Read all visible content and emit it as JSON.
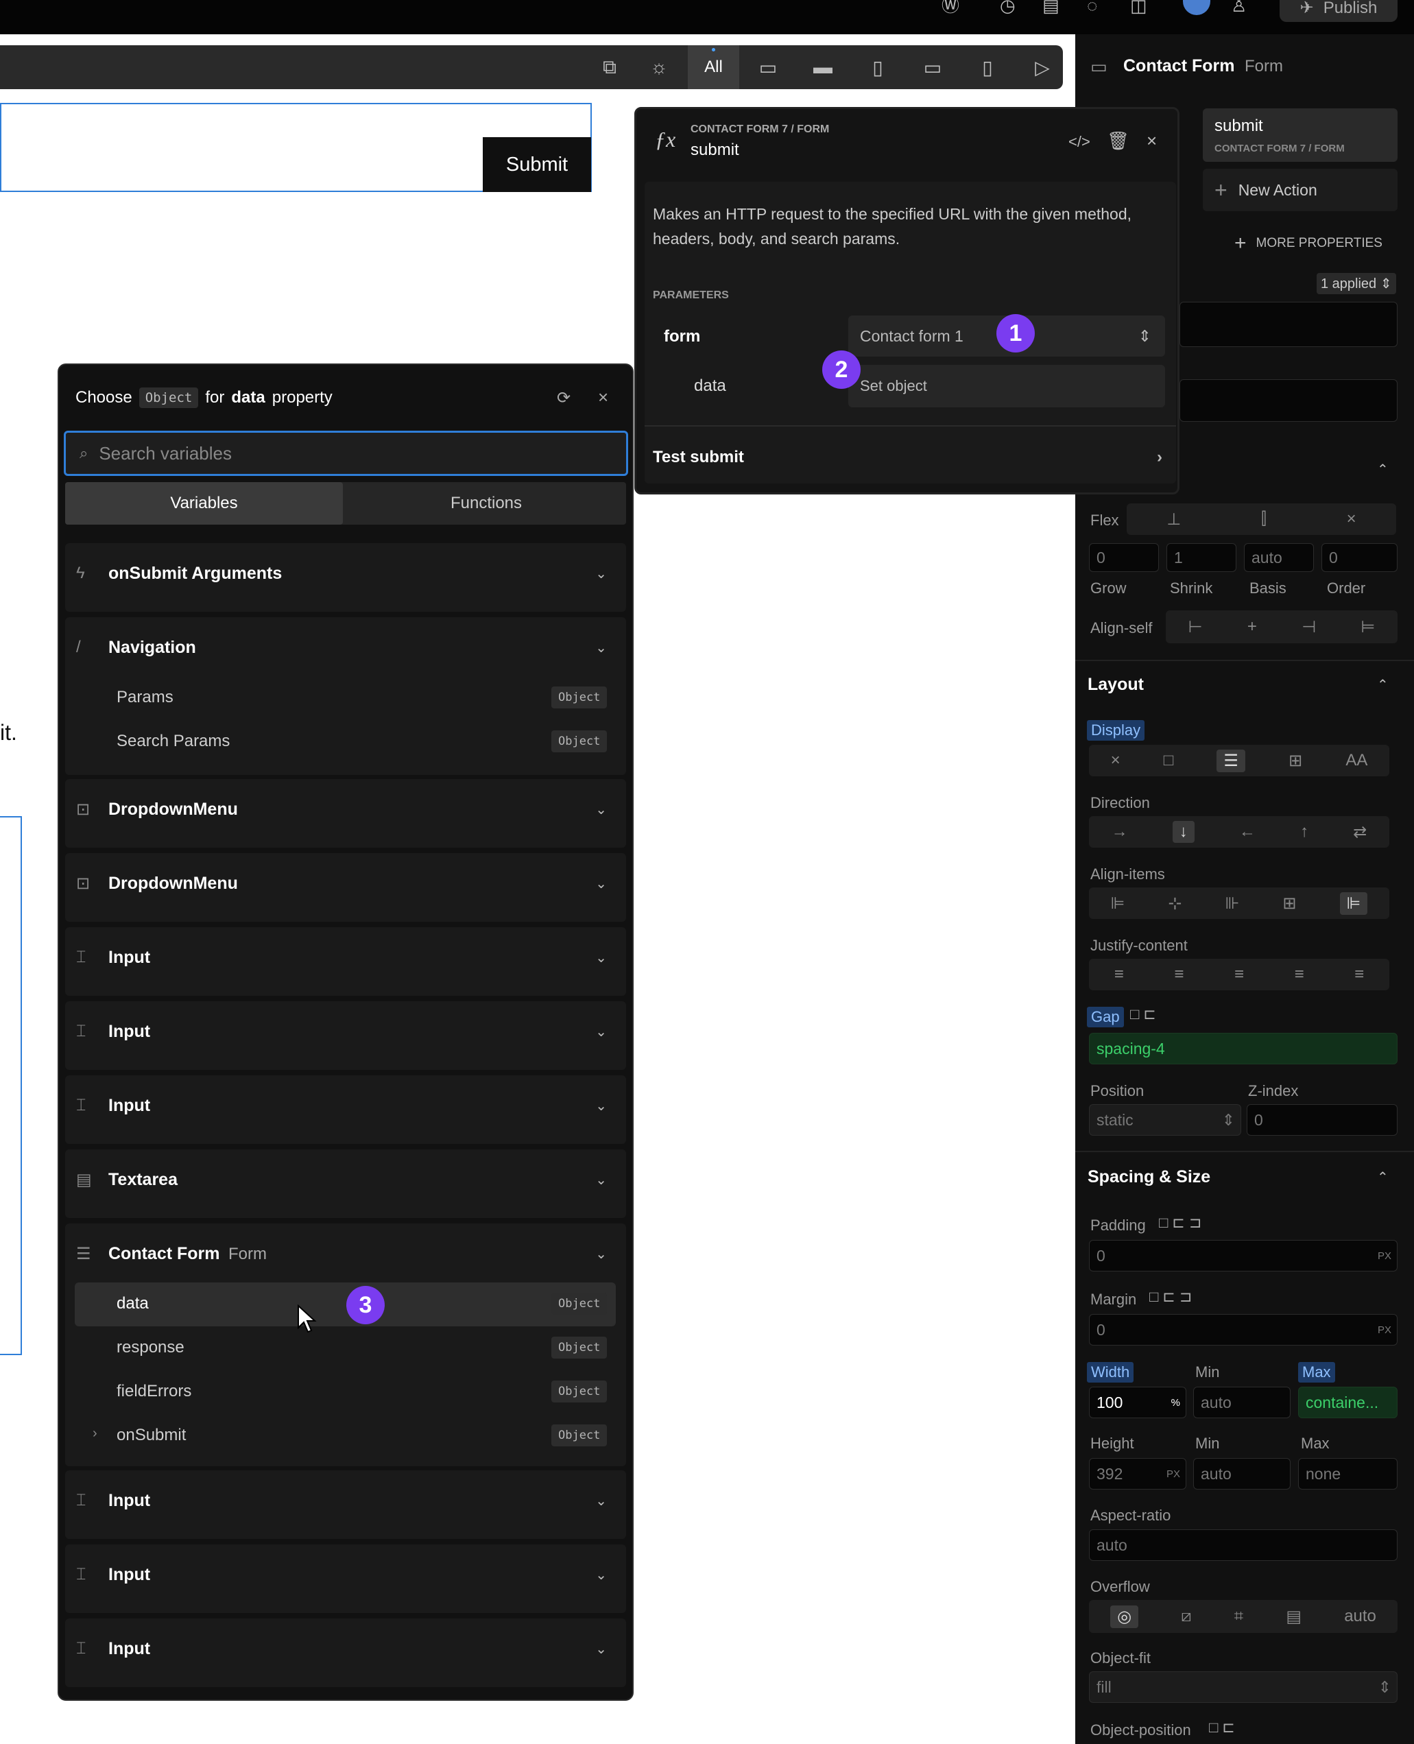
{
  "topbar": {
    "publish_label": "Publish",
    "icons": [
      "wordpress-icon",
      "history-icon",
      "keyboard-icon",
      "comment-icon",
      "book-icon",
      "avatar",
      "users-icon"
    ]
  },
  "toolbar": {
    "all_label": "All",
    "icons": [
      "external-link-icon",
      "sun-icon",
      "desktop-icon",
      "laptop-icon",
      "tablet-icon",
      "tablet-landscape-icon",
      "phone-icon",
      "play-icon"
    ]
  },
  "canvas": {
    "submit_label": "Submit",
    "fragment_text": "it."
  },
  "action_popup": {
    "breadcrumb": "CONTACT FORM 7 / FORM",
    "title": "submit",
    "description": "Makes an HTTP request to the specified URL with the given method, headers, body, and search params.",
    "parameters_label": "PARAMETERS",
    "form_label": "form",
    "form_value": "Contact form 1",
    "data_label": "data",
    "data_placeholder": "Set object",
    "test_label": "Test submit"
  },
  "markers": [
    "1",
    "2",
    "3"
  ],
  "chooser": {
    "prefix": "Choose",
    "type_badge": "Object",
    "for_label": "for",
    "property_name": "data",
    "property_label": "property",
    "search_placeholder": "Search variables",
    "tabs": [
      "Variables",
      "Functions"
    ],
    "groups": [
      {
        "title": "onSubmit Arguments",
        "icon": "lightning-icon"
      },
      {
        "title": "Navigation",
        "icon": "slash-icon",
        "items": [
          {
            "label": "Params",
            "badge": "Object"
          },
          {
            "label": "Search Params",
            "badge": "Object"
          }
        ]
      },
      {
        "title": "DropdownMenu",
        "icon": "dropdown-icon"
      },
      {
        "title": "DropdownMenu",
        "icon": "dropdown-icon"
      },
      {
        "title": "Input",
        "icon": "input-icon"
      },
      {
        "title": "Input",
        "icon": "input-icon"
      },
      {
        "title": "Input",
        "icon": "input-icon"
      },
      {
        "title": "Textarea",
        "icon": "textarea-icon"
      },
      {
        "title": "Contact Form",
        "subtitle": "Form",
        "icon": "form-icon",
        "items": [
          {
            "label": "data",
            "badge": "Object"
          },
          {
            "label": "response",
            "badge": "Object"
          },
          {
            "label": "fieldErrors",
            "badge": "Object"
          },
          {
            "label": "onSubmit",
            "badge": "Object"
          }
        ]
      },
      {
        "title": "Input",
        "icon": "input-icon"
      },
      {
        "title": "Input",
        "icon": "input-icon"
      },
      {
        "title": "Input",
        "icon": "input-icon"
      }
    ]
  },
  "rpanel": {
    "title": "Contact Form",
    "subtitle": "Form",
    "action_name": "submit",
    "action_source": "CONTACT FORM 7 / FORM",
    "new_action": "New Action",
    "more_properties": "MORE PROPERTIES",
    "applied": "1 applied",
    "flex_label": "Flex",
    "flex_values": [
      "0",
      "1",
      "auto",
      "0"
    ],
    "flex_labels": [
      "Grow",
      "Shrink",
      "Basis",
      "Order"
    ],
    "align_self": "Align-self",
    "layout": {
      "title": "Layout",
      "display": "Display",
      "direction": "Direction",
      "align_items": "Align-items",
      "justify_content": "Justify-content",
      "gap": "Gap",
      "gap_value": "spacing-4",
      "position": "Position",
      "position_value": "static",
      "zindex": "Z-index",
      "zindex_value": "0"
    },
    "spacing": {
      "title": "Spacing & Size",
      "padding": "Padding",
      "padding_value": "0",
      "margin": "Margin",
      "margin_value": "0",
      "unit_px": "PX",
      "unit_pct": "%",
      "width": "Width",
      "width_value": "100",
      "min": "Min",
      "max": "Max",
      "width_min": "auto",
      "width_max": "containe...",
      "height": "Height",
      "height_value": "392",
      "height_min": "auto",
      "height_max": "none",
      "aspect": "Aspect-ratio",
      "aspect_value": "auto",
      "overflow": "Overflow",
      "overflow_auto": "auto",
      "object_fit": "Object-fit",
      "object_fit_value": "fill",
      "object_position": "Object-position",
      "display_aa": "AA"
    }
  }
}
